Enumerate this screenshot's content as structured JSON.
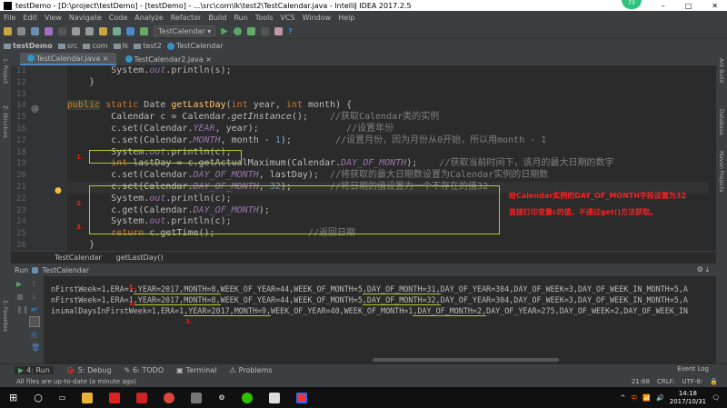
{
  "window": {
    "title": "testDemo - [D:\\project\\testDemo] - [testDemo] - ...\\src\\com\\lk\\test2\\TestCalendar.java - IntelliJ IDEA 2017.2.5",
    "badge": "73"
  },
  "menu": [
    "File",
    "Edit",
    "View",
    "Navigate",
    "Code",
    "Analyze",
    "Refactor",
    "Build",
    "Run",
    "Tools",
    "VCS",
    "Window",
    "Help"
  ],
  "toolbar": {
    "run_config": "TestCalendar"
  },
  "nav": [
    "testDemo",
    "src",
    "com",
    "lk",
    "test2",
    "TestCalendar"
  ],
  "tabs": [
    "TestCalendar.java",
    "TestCalendar2.java"
  ],
  "left_tools": [
    "1: Project",
    "Z: Structure",
    "2: Favorites"
  ],
  "right_tools": [
    "Ant Build",
    "Database",
    "Maven Projects"
  ],
  "gutter": [
    "11",
    "12",
    "13",
    "14",
    "15",
    "16",
    "17",
    "18",
    "19",
    "20",
    "21",
    "22",
    "23",
    "24",
    "25",
    "26"
  ],
  "code": [
    [
      [
        "",
        "        System."
      ],
      [
        "it",
        "out"
      ],
      [
        "",
        ".println(s);"
      ]
    ],
    [
      [
        "",
        "    }"
      ]
    ],
    [
      [
        "",
        ""
      ]
    ],
    [
      [
        "pub",
        "public"
      ],
      [
        "kw",
        " static "
      ],
      [
        "",
        "Date "
      ],
      [
        "fn",
        "getLastDay"
      ],
      [
        "",
        "("
      ],
      [
        "kw",
        "int "
      ],
      [
        "",
        "year, "
      ],
      [
        "kw",
        "int "
      ],
      [
        "",
        "month) {"
      ]
    ],
    [
      [
        "",
        "        Calendar c = Calendar."
      ],
      [
        "sit",
        "getInstance"
      ],
      [
        "",
        "();    "
      ],
      [
        "cm",
        "//获取Calendar类的实例"
      ]
    ],
    [
      [
        "",
        "        c.set(Calendar."
      ],
      [
        "it",
        "YEAR"
      ],
      [
        "",
        ", year);                "
      ],
      [
        "cm",
        "//设置年份"
      ]
    ],
    [
      [
        "",
        "        c.set(Calendar."
      ],
      [
        "it",
        "MONTH"
      ],
      [
        "",
        ", month - "
      ],
      [
        "nm",
        "1"
      ],
      [
        "",
        ");        "
      ],
      [
        "cm",
        "//设置月份，因为月份从0开始，所以用month - 1"
      ]
    ],
    [
      [
        "",
        "        System."
      ],
      [
        "it",
        "out"
      ],
      [
        "",
        ".println(c);"
      ]
    ],
    [
      [
        "kw",
        "        int "
      ],
      [
        "",
        "lastDay = c.getActualMaximum(Calendar."
      ],
      [
        "it",
        "DAY_OF_MONTH"
      ],
      [
        "",
        ");    "
      ],
      [
        "cm",
        "//获取当前时间下，该月的最大日期的数字"
      ]
    ],
    [
      [
        "",
        "        c.set(Calendar."
      ],
      [
        "it",
        "DAY_OF_MONTH"
      ],
      [
        "",
        ", lastDay);  "
      ],
      [
        "cm",
        "//将获取的最大日期数设置为Calendar实例的日期数"
      ]
    ],
    [
      [
        "",
        "        c.set(Calendar."
      ],
      [
        "it",
        "DAY_OF_MONTH"
      ],
      [
        "",
        ", "
      ],
      [
        "nm",
        "32"
      ],
      [
        "",
        ");       "
      ],
      [
        "cm",
        "//将日期的值设置为一个不存在的值32"
      ]
    ],
    [
      [
        "",
        "        System."
      ],
      [
        "it",
        "out"
      ],
      [
        "",
        ".println(c);"
      ]
    ],
    [
      [
        "",
        "        c.get(Calendar."
      ],
      [
        "it",
        "DAY_OF_MONTH"
      ],
      [
        "",
        ");"
      ]
    ],
    [
      [
        "",
        "        System."
      ],
      [
        "it",
        "out"
      ],
      [
        "",
        ".println(c);"
      ]
    ],
    [
      [
        "kw",
        "        return "
      ],
      [
        "",
        "c.getTime();                 "
      ],
      [
        "cm",
        "//返回日期"
      ]
    ],
    [
      [
        "",
        "    }"
      ]
    ]
  ],
  "markers": [
    "1.",
    "2.",
    "3."
  ],
  "annotations": [
    "给Calendar实例的DAY_OF_MONTH字段设置为32",
    "直接打印变量c的值，不通过get()方法获取。"
  ],
  "breadcrumb": [
    "TestCalendar",
    "getLastDay()"
  ],
  "run": {
    "label": "Run",
    "config": "TestCalendar"
  },
  "console": [
    [
      [
        "",
        "nFirstWeek=1,ERA=1"
      ],
      [
        "u",
        ",YEAR=2017,MONTH=8,"
      ],
      [
        "",
        "WEEK_OF_YEAR=44,WEEK_OF_MONTH=5"
      ],
      [
        "u",
        ",DAY_OF_MONTH=31,"
      ],
      [
        "",
        "DAY_OF_YEAR=304,DAY_OF_WEEK=3,DAY_OF_WEEK_IN_MONTH=5,A"
      ]
    ],
    [
      [
        "",
        "nFirstWeek=1,ERA=1"
      ],
      [
        "u",
        ",YEAR=2017,MONTH=8,"
      ],
      [
        "",
        "WEEK_OF_YEAR=44,WEEK_OF_MONTH=5"
      ],
      [
        "u",
        ",DAY_OF_MONTH=32,"
      ],
      [
        "",
        "DAY_OF_YEAR=304,DAY_OF_WEEK=3,DAY_OF_WEEK_IN_MONTH=5,A"
      ]
    ],
    [
      [
        "",
        "inimalDaysInFirstWeek=1,ERA=1"
      ],
      [
        "u",
        ",YEAR=2017,MONTH=9,"
      ],
      [
        "",
        "WEEK_OF_YEAR=40,WEEK_OF_MONTH=1"
      ],
      [
        "u",
        ",DAY_OF_MONTH=2,"
      ],
      [
        "",
        "DAY_OF_YEAR=275,DAY_OF_WEEK=2,DAY_OF_WEEK_IN"
      ]
    ]
  ],
  "bottom_tabs": [
    "4: Run",
    "5: Debug",
    "6: TODO",
    "Terminal",
    "Problems"
  ],
  "event_log": "Event Log",
  "status": {
    "message": "All files are up-to-date (a minute ago)",
    "position": "21:68",
    "line_sep": "CRLF:",
    "encoding": "UTF-8:"
  },
  "clock": {
    "time": "14:18",
    "date": "2017/10/31"
  },
  "colors": {
    "editor_bg": "#2b2b2b",
    "panel_bg": "#3c3f41",
    "highlight_box": "#b5c92b",
    "annotation": "#ff2020"
  }
}
